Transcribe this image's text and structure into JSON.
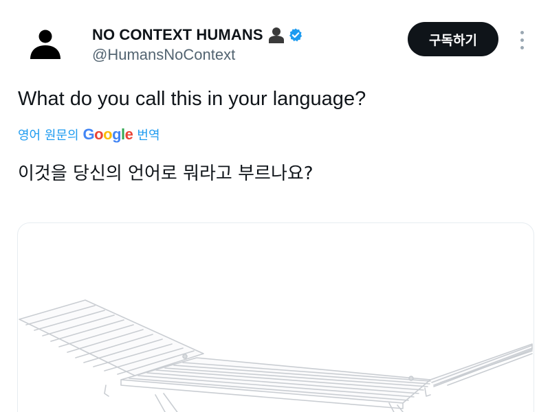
{
  "author": {
    "display_name": "NO CONTEXT HUMANS",
    "handle": "@HumansNoContext",
    "avatar_icon": "person-silhouette-icon",
    "name_emoji_icon": "bust-silhouette-icon",
    "verified_icon": "verified-badge-icon",
    "verified_color": "#1d9bf0"
  },
  "actions": {
    "subscribe_label": "구독하기",
    "more_icon": "more-vertical-icon"
  },
  "tweet": {
    "text": "What do you call this in your language?",
    "translation": {
      "prefix": "영어 원문의",
      "provider_letters": [
        "G",
        "o",
        "o",
        "g",
        "l",
        "e"
      ],
      "provider_colors": [
        "#4285F4",
        "#EA4335",
        "#FBBC05",
        "#4285F4",
        "#34A853",
        "#EA4335"
      ],
      "suffix": "번역",
      "translated_text": "이것을 당신의 언어로 뭐라고 부르나요?"
    }
  },
  "media": {
    "image_subject": "drying-rack-image"
  },
  "colors": {
    "text_primary": "#0f1419",
    "text_secondary": "#536471",
    "accent": "#1d9bf0",
    "button_bg": "#0f1419"
  }
}
